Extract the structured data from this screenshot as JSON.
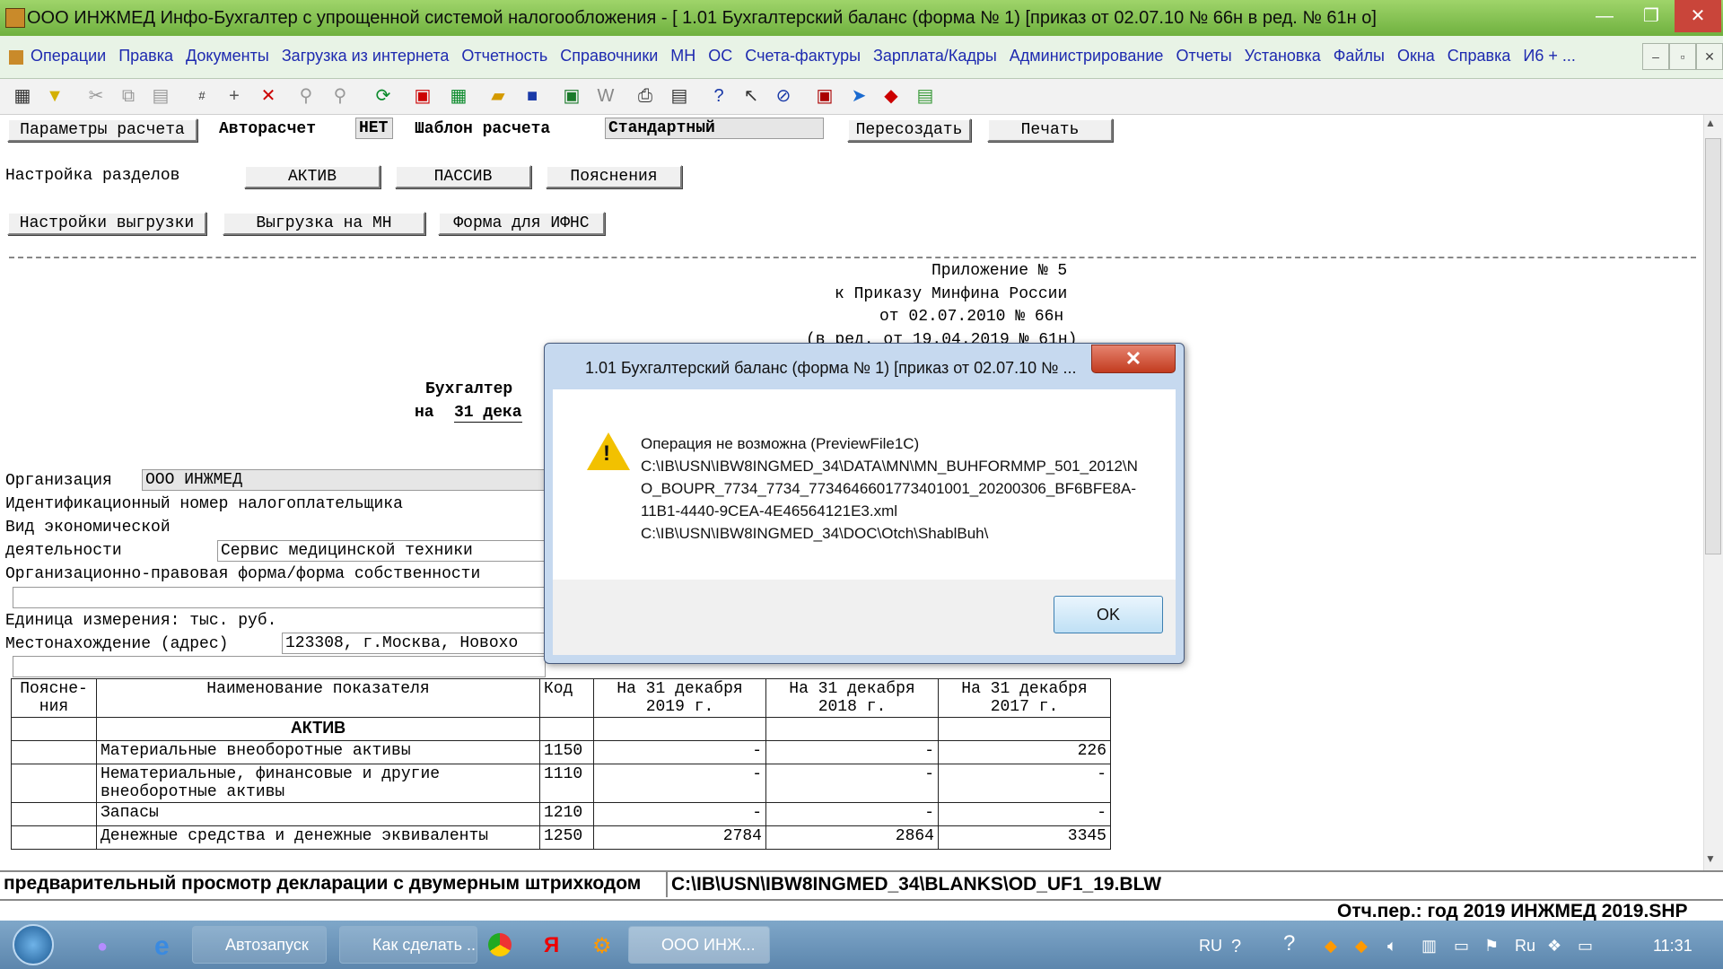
{
  "window": {
    "title": "ООО ИНЖМЕД Инфо-Бухгалтер с упрощенной системой налогообложения - [       1.01      Бухгалтерский баланс  (форма № 1)  [приказ от 02.07.10 № 66н в ред. № 61н о]",
    "minimize": "—",
    "restore": "❐",
    "close": "✕"
  },
  "menu": {
    "items": [
      "Операции",
      "Правка",
      "Документы",
      "Загрузка из интернета",
      "Отчетность",
      "Справочники",
      "МН",
      "ОС",
      "Счета-фактуры",
      "Зарплата/Кадры",
      "Администрирование",
      "Отчеты",
      "Установка",
      "Файлы",
      "Окна",
      "Справка",
      "И6 + ..."
    ],
    "mdi_min": "–",
    "mdi_restore": "▫",
    "mdi_close": "✕"
  },
  "toolbar": {
    "icons": [
      "table-icon",
      "filter-icon",
      "cut-icon",
      "copy-icon",
      "paste-icon",
      "number-icon",
      "add-icon",
      "delete-icon",
      "pin-icon",
      "pin2-icon",
      "refresh-icon",
      "pdf-icon",
      "calculator-icon",
      "open-folder-icon",
      "save-icon",
      "excel-icon",
      "word-icon",
      "print-icon",
      "preview-icon",
      "help-icon",
      "context-help-icon",
      "compass-icon",
      "module-icon",
      "bird-icon",
      "acrobat-icon",
      "notepad-icon"
    ]
  },
  "form": {
    "params_btn": "Параметры расчета",
    "autocalc_label": "Авторасчет",
    "autocalc_value": "НЕТ",
    "template_label": "Шаблон расчета",
    "template_value": "Стандартный",
    "recreate_btn": "Пересоздать",
    "print_btn": "Печать",
    "sections_label": "Настройка разделов",
    "active_btn": "АКТИВ",
    "passive_btn": "ПАССИВ",
    "notes_btn": "Пояснения",
    "export_settings_btn": "Настройки выгрузки",
    "export_mn_btn": "Выгрузка на МН",
    "ifns_btn": "Форма для ИФНС"
  },
  "document": {
    "appendix1": "Приложение № 5",
    "appendix2": "к Приказу Минфина России",
    "appendix3": "от 02.07.2010 № 66н",
    "appendix4": "(в ред. от 19.04.2019 № 61н)",
    "heading1": "Бухгалтер",
    "heading2_prefix": "на",
    "heading2_date": "31 дека",
    "org_label": "Организация",
    "org_value": "ООО ИНЖМЕД",
    "inn_label": "Идентификационный номер налогоплательщика",
    "activity_label1": "Вид экономической",
    "activity_label2": "деятельности",
    "activity_value": "Сервис медицинской техники",
    "legal_form_label": "Организационно-правовая форма/форма собственности",
    "unit_label": "Единица измерения: тыс. руб.",
    "address_label": "Местонахождение (адрес)",
    "address_value": "123308, г.Москва, Новохо"
  },
  "table": {
    "headers": {
      "notes": "Поясне-\nния",
      "name": "Наименование показателя",
      "code": "Код",
      "y2019": "На 31 декабря\n2019 г.",
      "y2018": "На 31 декабря\n2018 г.",
      "y2017": "На 31 декабря\n2017 г."
    },
    "section": "АКТИВ",
    "rows": [
      {
        "name": "Материальные внеоборотные активы",
        "code": "1150",
        "v2019": "-",
        "v2018": "-",
        "v2017": "226"
      },
      {
        "name": "Нематериальные, финансовые и другие\nвнеоборотные активы",
        "code": "1110",
        "v2019": "-",
        "v2018": "-",
        "v2017": "-"
      },
      {
        "name": "Запасы",
        "code": "1210",
        "v2019": "-",
        "v2018": "-",
        "v2017": "-"
      },
      {
        "name": "Денежные средства и денежные эквиваленты",
        "code": "1250",
        "v2019": "2784",
        "v2018": "2864",
        "v2017": "3345"
      }
    ]
  },
  "status": {
    "left": "предварительный просмотр декларации с двумерным штрихкодом",
    "path": "C:\\IB\\USN\\IBW8INGMED_34\\BLANKS\\OD_UF1_19.BLW",
    "period": "Отч.пер.: год 2019 ИНЖМЕД 2019.SHP"
  },
  "dialog": {
    "title": "1.01      Бухгалтерский баланс  (форма № 1)  [приказ от 02.07.10 № ...",
    "close": "✕",
    "message_line1": "Операция не возможна (PreviewFile1C)",
    "message_line2": "C:\\IB\\USN\\IBW8INGMED_34\\DATA\\MN\\MN_BUHFORMMP_501_2012\\NO_BOUPR_7734_7734_7734646601773401001_20200306_BF6BFE8A-11B1-4440-9CEA-4E46564121E3.xml",
    "message_line3": "C:\\IB\\USN\\IBW8INGMED_34\\DOC\\Otch\\ShablBuh\\",
    "ok": "OK"
  },
  "taskbar": {
    "autorun": "Автозапуск",
    "firefox": "Как сделать ...",
    "app": "ООО ИНЖ...",
    "lang": "RU",
    "lang2": "Ru",
    "time": "11:31"
  }
}
